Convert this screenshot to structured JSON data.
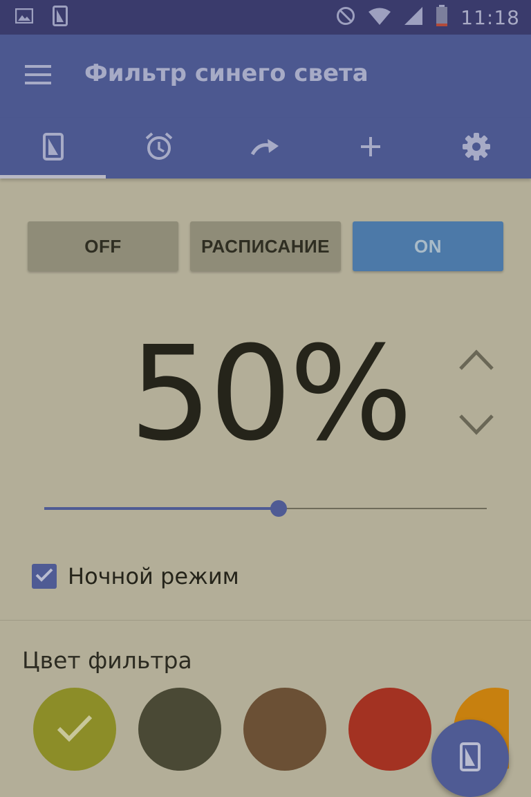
{
  "status_bar": {
    "time": "11:18",
    "left_icons": [
      "image-icon",
      "phone-filter-icon"
    ],
    "right_icons": [
      "do-not-disturb-icon",
      "wifi-icon",
      "signal-icon",
      "battery-icon"
    ]
  },
  "app_bar": {
    "menu_icon": "menu-icon",
    "title": "Фильтр синего света"
  },
  "tabs": [
    {
      "icon": "phone-filter-icon",
      "selected": true
    },
    {
      "icon": "alarm-clock-icon",
      "selected": false
    },
    {
      "icon": "redo-arrow-icon",
      "selected": false
    },
    {
      "icon": "plus-icon",
      "selected": false
    },
    {
      "icon": "gear-icon",
      "selected": false
    }
  ],
  "mode_buttons": {
    "off_label": "OFF",
    "schedule_label": "РАСПИСАНИЕ",
    "on_label": "ON",
    "selected": "ON"
  },
  "intensity": {
    "display": "50%",
    "slider_value_percent": 53
  },
  "night_mode": {
    "label": "Ночной режим",
    "checked": true
  },
  "filter_color": {
    "title": "Цвет фильтра",
    "selected_index": 0,
    "swatches": [
      "#8c8d28",
      "#4a4935",
      "#6b5035",
      "#a33222",
      "#c7800f"
    ]
  },
  "colors": {
    "app_bar": "#4c5890",
    "status_bar": "#3a3b6c",
    "background": "#b3ae98",
    "accent": "#4f5b94",
    "on_button": "#4c79a8"
  }
}
